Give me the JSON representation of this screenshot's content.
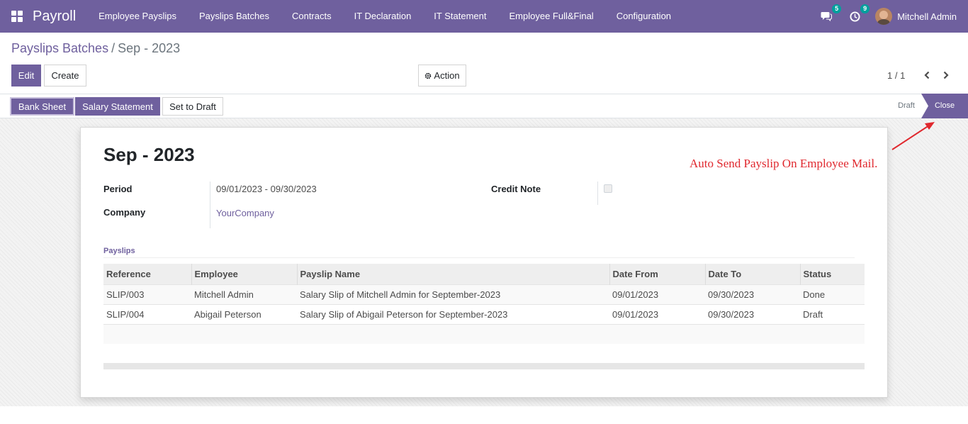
{
  "navbar": {
    "brand": "Payroll",
    "menu": [
      "Employee Payslips",
      "Payslips Batches",
      "Contracts",
      "IT Declaration",
      "IT Statement",
      "Employee Full&Final",
      "Configuration"
    ],
    "messages_count": "5",
    "activities_count": "9",
    "user_name": "Mitchell Admin",
    "color": "#6f609e"
  },
  "breadcrumb": {
    "parent": "Payslips Batches",
    "separator": "/",
    "current": "Sep - 2023"
  },
  "controls": {
    "edit": "Edit",
    "create": "Create",
    "action": "Action",
    "pager": "1 / 1"
  },
  "statusbar": {
    "buttons": {
      "bank_sheet": "Bank Sheet",
      "salary_statement": "Salary Statement",
      "set_to_draft": "Set to Draft"
    },
    "stages": {
      "draft": "Draft",
      "close": "Close"
    },
    "active_stage": "Close"
  },
  "record": {
    "title": "Sep - 2023",
    "period_label": "Period",
    "period_value": "09/01/2023 - 09/30/2023",
    "company_label": "Company",
    "company_value": "YourCompany",
    "credit_note_label": "Credit Note",
    "credit_note_checked": false
  },
  "payslips": {
    "section_title": "Payslips",
    "columns": [
      "Reference",
      "Employee",
      "Payslip Name",
      "Date From",
      "Date To",
      "Status"
    ],
    "rows": [
      [
        "SLIP/003",
        "Mitchell Admin",
        "Salary Slip of Mitchell Admin for September-2023",
        "09/01/2023",
        "09/30/2023",
        "Done"
      ],
      [
        "SLIP/004",
        "Abigail Peterson",
        "Salary Slip of Abigail Peterson for September-2023",
        "09/01/2023",
        "09/30/2023",
        "Draft"
      ]
    ]
  },
  "annotation": {
    "text": "Auto Send Payslip On Employee Mail.",
    "color": "#e0282e"
  }
}
